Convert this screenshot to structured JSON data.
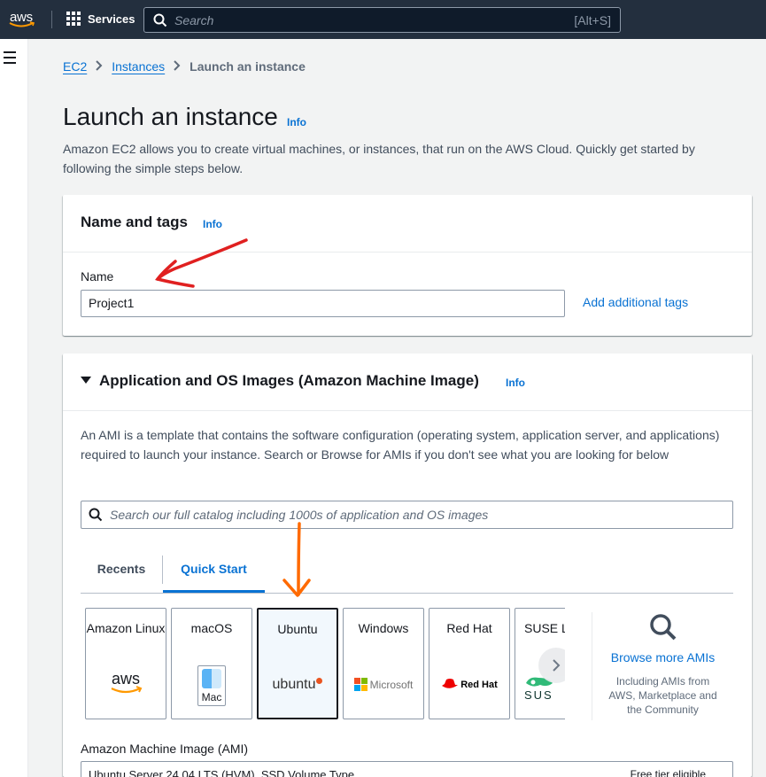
{
  "topnav": {
    "logo_text": "aws",
    "services_label": "Services",
    "search_placeholder": "Search",
    "search_shortcut": "[Alt+S]"
  },
  "breadcrumb": {
    "items": [
      "EC2",
      "Instances"
    ],
    "current": "Launch an instance"
  },
  "page": {
    "title": "Launch an instance",
    "info": "Info",
    "description": "Amazon EC2 allows you to create virtual machines, or instances, that run on the AWS Cloud. Quickly get started by following the simple steps below."
  },
  "name_panel": {
    "heading": "Name and tags",
    "info": "Info",
    "name_label": "Name",
    "name_value": "Project1",
    "add_tags": "Add additional tags"
  },
  "ami_panel": {
    "heading": "Application and OS Images (Amazon Machine Image)",
    "info": "Info",
    "description": "An AMI is a template that contains the software configuration (operating system, application server, and applications) required to launch your instance. Search or Browse for AMIs if you don't see what you are looking for below",
    "search_placeholder": "Search our full catalog including 1000s of application and OS images",
    "tabs": [
      "Recents",
      "Quick Start"
    ],
    "active_tab": "Quick Start",
    "tiles": [
      {
        "name": "Amazon Linux",
        "logo": "aws"
      },
      {
        "name": "macOS",
        "logo": "Mac"
      },
      {
        "name": "Ubuntu",
        "logo": "ubuntu"
      },
      {
        "name": "Windows",
        "logo": "Microsoft"
      },
      {
        "name": "Red Hat",
        "logo": "Red Hat"
      },
      {
        "name": "SUSE Li",
        "logo": "SUS"
      }
    ],
    "selected_tile": "Ubuntu",
    "browse_more": "Browse more AMIs",
    "browse_sub": "Including AMIs from AWS, Marketplace and the Community",
    "ami_label": "Amazon Machine Image (AMI)",
    "ami_value": "Ubuntu Server 24.04 LTS (HVM), SSD Volume Type",
    "ami_badge": "Free tier eligible"
  },
  "colors": {
    "nav_bg": "#232f3e",
    "link": "#0972d3",
    "annotation_red": "#e02020",
    "annotation_orange": "#ff6a00"
  }
}
